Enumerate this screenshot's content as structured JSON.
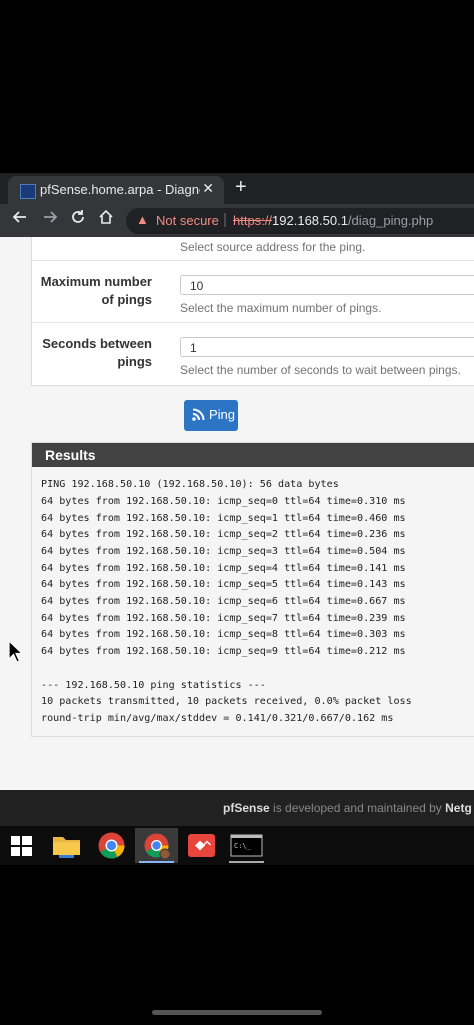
{
  "browser": {
    "tab_title": "pfSense.home.arpa - Diagnostics",
    "tab_close": "✕",
    "new_tab": "+",
    "security_label": "Not secure",
    "url_scheme": "https://",
    "url_host": "192.168.50.1",
    "url_path": "/diag_ping.php"
  },
  "form": {
    "source_help": "Select source address for the ping.",
    "max_pings": {
      "label_line1": "Maximum number",
      "label_line2": "of pings",
      "value": "10",
      "help": "Select the maximum number of pings."
    },
    "seconds_between": {
      "label_line1": "Seconds between",
      "label_line2": "pings",
      "value": "1",
      "help": "Select the number of seconds to wait between pings."
    },
    "ping_button": "Ping"
  },
  "results": {
    "title": "Results",
    "header_line": "PING 192.168.50.10 (192.168.50.10): 56 data bytes",
    "replies": [
      "64 bytes from 192.168.50.10: icmp_seq=0 ttl=64 time=0.310 ms",
      "64 bytes from 192.168.50.10: icmp_seq=1 ttl=64 time=0.460 ms",
      "64 bytes from 192.168.50.10: icmp_seq=2 ttl=64 time=0.236 ms",
      "64 bytes from 192.168.50.10: icmp_seq=3 ttl=64 time=0.504 ms",
      "64 bytes from 192.168.50.10: icmp_seq=4 ttl=64 time=0.141 ms",
      "64 bytes from 192.168.50.10: icmp_seq=5 ttl=64 time=0.143 ms",
      "64 bytes from 192.168.50.10: icmp_seq=6 ttl=64 time=0.667 ms",
      "64 bytes from 192.168.50.10: icmp_seq=7 ttl=64 time=0.239 ms",
      "64 bytes from 192.168.50.10: icmp_seq=8 ttl=64 time=0.303 ms",
      "64 bytes from 192.168.50.10: icmp_seq=9 ttl=64 time=0.212 ms"
    ],
    "stats_header": "--- 192.168.50.10 ping statistics ---",
    "stats_packets": "10 packets transmitted, 10 packets received, 0.0% packet loss",
    "stats_rtt": "round-trip min/avg/max/stddev = 0.141/0.321/0.667/0.162 ms"
  },
  "footer": {
    "brand": "pfSense",
    "text": " is developed and maintained by ",
    "brand2": "Netg"
  },
  "taskbar": {
    "items": [
      "windows-start-icon",
      "file-explorer-icon",
      "chrome-icon",
      "chrome-profile-icon",
      "anydesk-icon",
      "command-prompt-icon"
    ],
    "cmd_label": "C:\\_"
  },
  "colors": {
    "accent": "#2c74c4",
    "results_header": "#424242",
    "not_secure": "#f28b82"
  }
}
